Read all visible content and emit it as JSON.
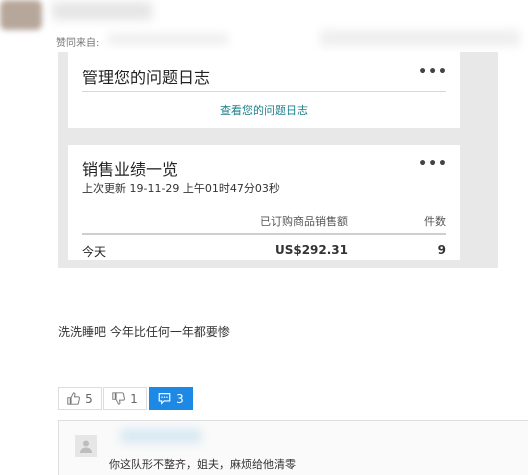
{
  "header": {
    "source_label": "赞同来自:"
  },
  "log_card": {
    "title": "管理您的问题日志",
    "more": "•••",
    "link": "查看您的问题日志"
  },
  "sales_card": {
    "title": "销售业绩一览",
    "more": "•••",
    "updated": "上次更新 19-11-29 上午01时47分03秒",
    "columns": [
      "已订购商品销售额",
      "件数"
    ],
    "row": {
      "label": "今天",
      "revenue": "US$292.31",
      "count": "9"
    }
  },
  "post": {
    "text": "洗洗睡吧 今年比任何一年都要惨"
  },
  "actions": {
    "like_count": "5",
    "dislike_count": "1",
    "comment_count": "3"
  },
  "comment": {
    "text": "你这队形不整齐，姐夫，麻烦给他清零"
  },
  "colors": {
    "accent": "#1e88e5",
    "link": "#1a7f8a",
    "panel_bg": "#e8e8e8"
  },
  "icons": [
    "thumb-up-icon",
    "thumb-down-icon",
    "comment-icon",
    "user-avatar-icon"
  ]
}
